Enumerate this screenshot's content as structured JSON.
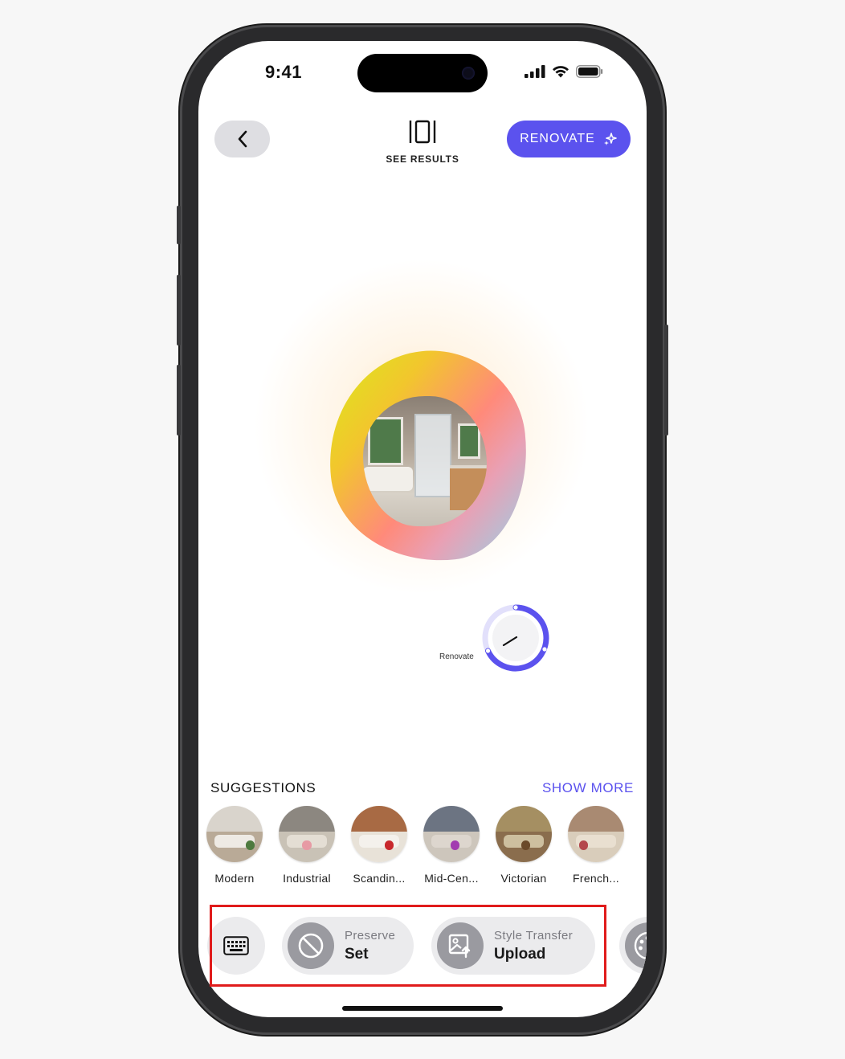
{
  "status": {
    "time": "9:41"
  },
  "header": {
    "see_results_label": "SEE RESULTS",
    "renovate_label": "RENOVATE"
  },
  "canvas": {
    "dial_label": "Renovate"
  },
  "suggestions": {
    "title": "SUGGESTIONS",
    "show_more": "SHOW MORE",
    "items": [
      {
        "label": "Modern"
      },
      {
        "label": "Industrial"
      },
      {
        "label": "Scandin..."
      },
      {
        "label": "Mid-Cen..."
      },
      {
        "label": "Victorian"
      },
      {
        "label": "French..."
      }
    ]
  },
  "toolbar": {
    "preserve": {
      "sub": "Preserve",
      "main": "Set"
    },
    "style_transfer": {
      "sub": "Style Transfer",
      "main": "Upload"
    }
  },
  "colors": {
    "accent": "#5b52ee",
    "highlight": "#e01b1b",
    "pill_background": "#ebebed"
  },
  "icons": {
    "back": "chevron-left-icon",
    "results": "compare-panels-icon",
    "renovate": "sparkles-icon",
    "keyboard": "keyboard-icon",
    "preserve": "prohibit-icon",
    "upload": "image-upload-icon",
    "palette": "palette-icon"
  }
}
